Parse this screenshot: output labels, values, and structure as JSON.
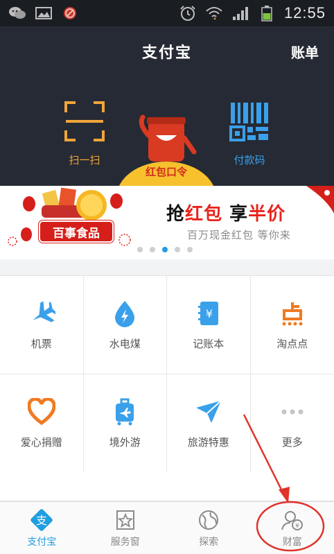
{
  "status_bar": {
    "time": "12:55"
  },
  "header": {
    "title": "支付宝",
    "right_action": "账单"
  },
  "hero": {
    "scan_label": "扫一扫",
    "pay_code_label": "付款码",
    "mascot_label": "红包口令"
  },
  "banner": {
    "title_part1": "抢",
    "title_part2": "红包",
    "title_part3": " 享",
    "title_part4": "半价",
    "subtitle": "百万现金红包 等你来",
    "brand": "百事食品",
    "dots": 5,
    "active_dot": 2
  },
  "grid": [
    {
      "label": "机票",
      "icon": "plane-icon"
    },
    {
      "label": "水电煤",
      "icon": "utility-drop-icon"
    },
    {
      "label": "记账本",
      "icon": "ledger-icon"
    },
    {
      "label": "淘点点",
      "icon": "taodiandian-icon"
    },
    {
      "label": "爱心捐赠",
      "icon": "heart-icon"
    },
    {
      "label": "境外游",
      "icon": "luggage-icon"
    },
    {
      "label": "旅游特惠",
      "icon": "paper-plane-icon"
    },
    {
      "label": "更多",
      "icon": "more-dots-icon"
    }
  ],
  "bottom_nav": [
    {
      "label": "支付宝",
      "icon": "alipay-icon",
      "active": true
    },
    {
      "label": "服务窗",
      "icon": "star-window-icon",
      "active": false
    },
    {
      "label": "探索",
      "icon": "globe-icon",
      "active": false
    },
    {
      "label": "财富",
      "icon": "wealth-icon",
      "active": false
    }
  ],
  "colors": {
    "accent": "#1f9ee0",
    "header_bg": "#262a34",
    "scan_orange": "#f0a53a",
    "annotation_red": "#e0322a"
  }
}
